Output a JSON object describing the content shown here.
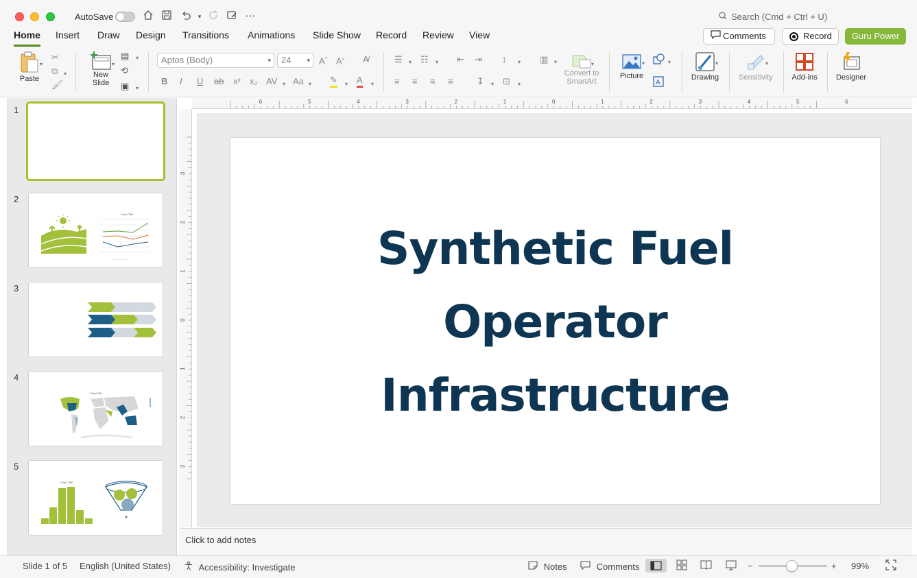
{
  "titlebar": {
    "autosave_label": "AutoSave",
    "search_placeholder": "Search (Cmd + Ctrl + U)"
  },
  "tabs": [
    {
      "label": "Home",
      "active": true
    },
    {
      "label": "Insert"
    },
    {
      "label": "Draw"
    },
    {
      "label": "Design"
    },
    {
      "label": "Transitions"
    },
    {
      "label": "Animations"
    },
    {
      "label": "Slide Show"
    },
    {
      "label": "Record"
    },
    {
      "label": "Review"
    },
    {
      "label": "View"
    }
  ],
  "header_buttons": {
    "comments": "Comments",
    "record": "Record",
    "guru": "Guru Power"
  },
  "ribbon": {
    "paste": "Paste",
    "new_slide": "New Slide",
    "font_name": "Aptos (Body)",
    "font_size": "24",
    "convert_smartart": "Convert to SmartArt",
    "picture": "Picture",
    "drawing": "Drawing",
    "sensitivity": "Sensitivity",
    "addins": "Add-ins",
    "designer": "Designer"
  },
  "slides": {
    "numbers": [
      "1",
      "2",
      "3",
      "4",
      "5"
    ],
    "thumb_texts": {
      "chart_title": "Chart Title"
    }
  },
  "ruler": {
    "h_ticks": [
      "6",
      "5",
      "4",
      "3",
      "2",
      "1",
      "0",
      "1",
      "2",
      "3",
      "4",
      "5",
      "6"
    ],
    "v_ticks": [
      "3",
      "2",
      "1",
      "0",
      "1",
      "2",
      "3"
    ]
  },
  "slide": {
    "title_lines": [
      "Synthetic Fuel",
      "Operator",
      "Infrastructure"
    ]
  },
  "notes": {
    "placeholder": "Click to add notes"
  },
  "status": {
    "slide_counter": "Slide 1 of 5",
    "language": "English (United States)",
    "accessibility": "Accessibility: Investigate",
    "notes": "Notes",
    "comments": "Comments",
    "zoom": "99%"
  },
  "colors": {
    "accent_green": "#86b83a",
    "title_navy": "#0e3652",
    "thumb_green": "#a3c03b",
    "thumb_blue": "#1d5f86"
  }
}
